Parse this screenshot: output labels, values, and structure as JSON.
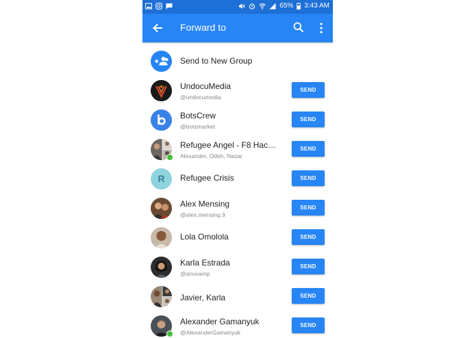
{
  "status_bar": {
    "battery": "65%",
    "time": "3:43 AM",
    "left_icons": [
      "gallery-icon",
      "instagram-icon",
      "message-icon"
    ],
    "right_icons": [
      "mute-icon",
      "alarm-icon",
      "wifi-icon",
      "signal-icon",
      "battery-icon"
    ]
  },
  "app_bar": {
    "title": "Forward to",
    "back_icon": "arrow-back-icon",
    "search_icon": "search-icon",
    "more_icon": "more-vert-icon"
  },
  "new_group": {
    "label": "Send to New Group",
    "icon": "group-add-icon"
  },
  "colors": {
    "status_bar": "#1e6fd6",
    "app_bar": "#2785f5",
    "send_button": "#2785f5",
    "online": "#44bf3a"
  },
  "contacts": [
    {
      "name": "UndocuMedia",
      "subtitle": "@undocumedia",
      "send_label": "SEND",
      "avatar": "undocumedia-logo",
      "online": false
    },
    {
      "name": "BotsCrew",
      "subtitle": "@botsmarket",
      "send_label": "SEND",
      "avatar": "botscrew-logo",
      "online": false
    },
    {
      "name": "Refugee Angel - F8 Hackat...",
      "subtitle": "Alexander, Odeh, Nazar",
      "send_label": "SEND",
      "avatar": "group-photo",
      "online": true
    },
    {
      "name": "Refugee Crisis",
      "subtitle": "",
      "send_label": "SEND",
      "avatar": "letter-r",
      "avatar_letter": "R",
      "online": false
    },
    {
      "name": "Alex Mensing",
      "subtitle": "@alex.mensing.9",
      "send_label": "SEND",
      "avatar": "user-photo",
      "online": false
    },
    {
      "name": "Lola Omolola",
      "subtitle": "",
      "send_label": "SEND",
      "avatar": "user-photo",
      "online": false
    },
    {
      "name": "Karla Estrada",
      "subtitle": "@anuvamp",
      "send_label": "SEND",
      "avatar": "user-photo",
      "online": false
    },
    {
      "name": "Javier, Karla",
      "subtitle": "",
      "send_label": "SEND",
      "avatar": "group-photo",
      "online": false
    },
    {
      "name": "Alexander Gamanyuk",
      "subtitle": "@AlexanderGamanyuk",
      "send_label": "SEND",
      "avatar": "user-photo",
      "online": true
    }
  ]
}
